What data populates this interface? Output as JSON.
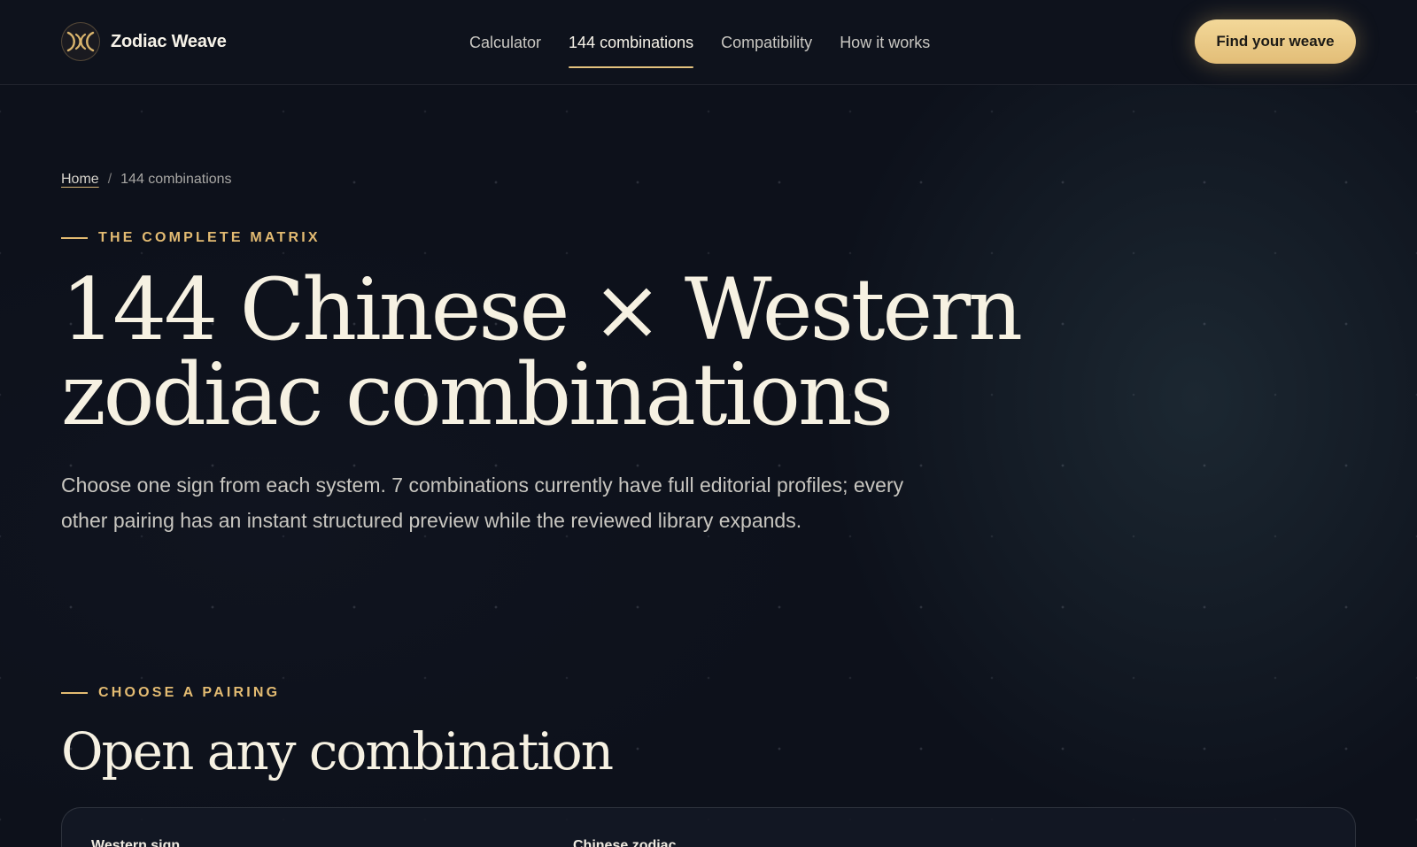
{
  "brand": {
    "name": "Zodiac Weave",
    "accent": "#e3bb72"
  },
  "nav": {
    "items": [
      {
        "label": "Calculator",
        "active": false
      },
      {
        "label": "144 combinations",
        "active": true
      },
      {
        "label": "Compatibility",
        "active": false
      },
      {
        "label": "How it works",
        "active": false
      }
    ],
    "cta_label": "Find your weave"
  },
  "breadcrumb": {
    "home": "Home",
    "current": "144 combinations"
  },
  "hero": {
    "eyebrow": "THE COMPLETE MATRIX",
    "title_line1": "144 Chinese × Western",
    "title_line2": "zodiac combinations",
    "lede": "Choose one sign from each system. 7 combinations currently have full editorial profiles; every other pairing has an instant structured preview while the reviewed library expands."
  },
  "picker": {
    "eyebrow": "CHOOSE A PAIRING",
    "title": "Open any combination",
    "western_label": "Western sign",
    "chinese_label": "Chinese zodiac"
  }
}
